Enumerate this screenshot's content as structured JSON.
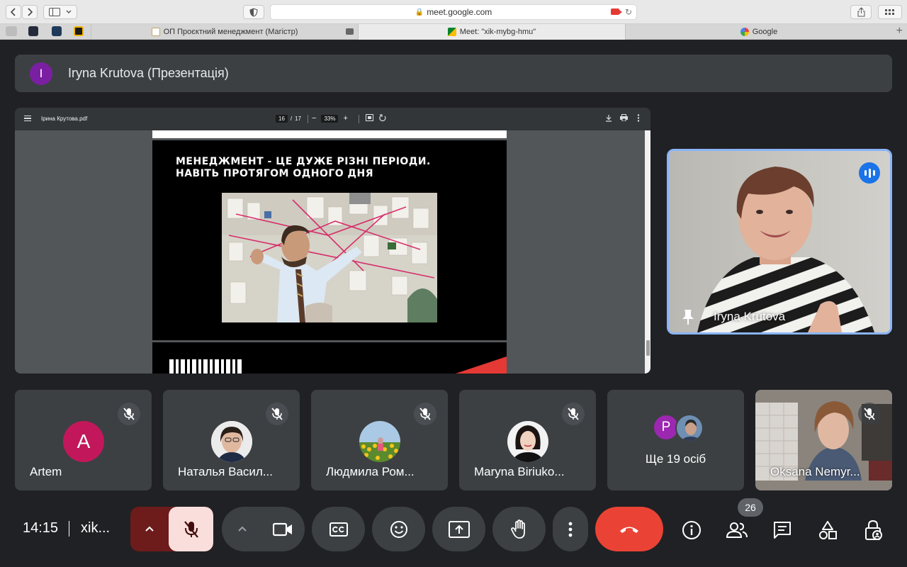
{
  "browser": {
    "url": "meet.google.com",
    "tabs": [
      {
        "label": "ОП Проєктний менеджмент (Магістр)",
        "active": false
      },
      {
        "label": "Meet: \"xik-mybg-hmu\"",
        "active": true
      },
      {
        "label": "Google",
        "active": false
      }
    ]
  },
  "presenter": {
    "avatar_letter": "I",
    "title": "Iryna Krutova (Презентація)"
  },
  "pdf": {
    "filename": "Ірина Крутова.pdf",
    "page_current": "16",
    "page_separator": "/",
    "page_total": "17",
    "zoom_minus": "−",
    "zoom": "33%",
    "zoom_plus": "+",
    "slide_title_line1": "МЕНЕДЖМЕНТ - ЦЕ ДУЖЕ РІЗНІ ПЕРІОДИ.",
    "slide_title_line2": "НАВІТЬ ПРОТЯГОМ ОДНОГО ДНЯ"
  },
  "speaker": {
    "name": "Iryna Krutova"
  },
  "participants": [
    {
      "name": "Artem",
      "avatar_letter": "A"
    },
    {
      "name": "Наталья Васил..."
    },
    {
      "name": "Людмила Ром..."
    },
    {
      "name": "Maryna Biriuko..."
    },
    {
      "more_avatar_letter": "P",
      "more_label": "Ще 19 осіб"
    },
    {
      "name": "Oksana Nemyr..."
    }
  ],
  "controls": {
    "time": "14:15",
    "meeting_code": "xik...",
    "participants_count": "26"
  },
  "colors": {
    "meet_bg": "#202124",
    "tile_bg": "#3c4043",
    "leave_red": "#ea4335",
    "mic_off_bg": "#f9dedc",
    "active_speaker_border": "#8ab4f8"
  }
}
